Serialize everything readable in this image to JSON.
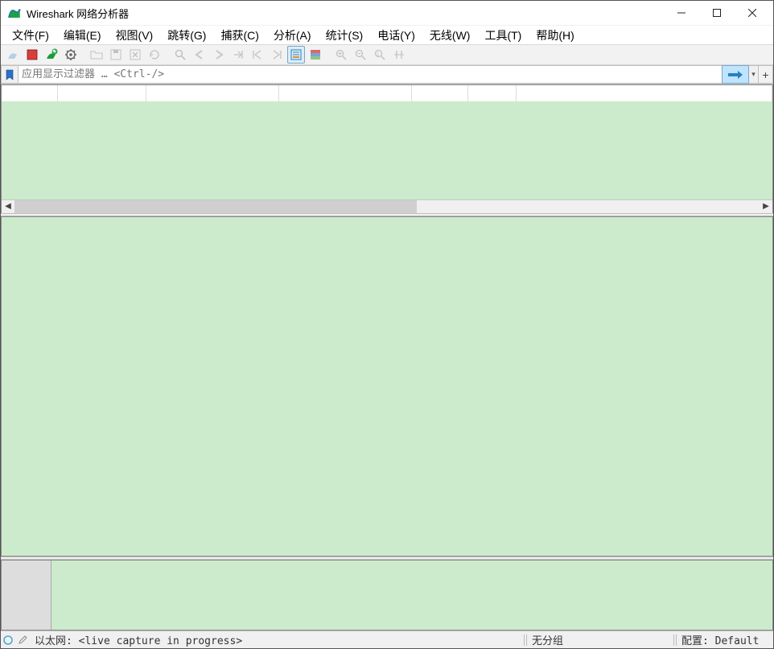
{
  "titlebar": {
    "title": "Wireshark 网络分析器"
  },
  "menu": {
    "file": "文件(F)",
    "edit": "编辑(E)",
    "view": "视图(V)",
    "go": "跳转(G)",
    "capture": "捕获(C)",
    "analyze": "分析(A)",
    "stats": "统计(S)",
    "telephony": "电话(Y)",
    "wireless": "无线(W)",
    "tools": "工具(T)",
    "help": "帮助(H)"
  },
  "filter": {
    "placeholder": "应用显示过滤器 … <Ctrl-/>"
  },
  "status": {
    "capture_text": "以太网: <live capture in progress>",
    "packets_text": "无分组",
    "profile_text": "配置: Default"
  },
  "colors": {
    "pane_green": "#ccebcc",
    "stop_red": "#d93d3d",
    "start_blue": "#2e70c2",
    "fin_blue": "#1b78c9",
    "restart_green": "#1a9c3c",
    "apply_blue": "#2b7fbf"
  },
  "toolbar": {
    "start": "start-capture-icon",
    "stop": "stop-capture-icon",
    "restart": "restart-capture-icon",
    "options": "capture-options-icon",
    "open": "open-file-icon",
    "save": "save-file-icon",
    "close": "close-file-icon",
    "reload": "reload-icon",
    "find": "find-packet-icon",
    "prev": "go-previous-icon",
    "next": "go-next-icon",
    "jump": "go-to-packet-icon",
    "first": "go-first-icon",
    "last": "go-last-icon",
    "autoscroll": "auto-scroll-icon",
    "colorize": "colorize-icon",
    "zoom_in": "zoom-in-icon",
    "zoom_out": "zoom-out-icon",
    "zoom_reset": "zoom-reset-icon",
    "resize_cols": "resize-columns-icon"
  }
}
